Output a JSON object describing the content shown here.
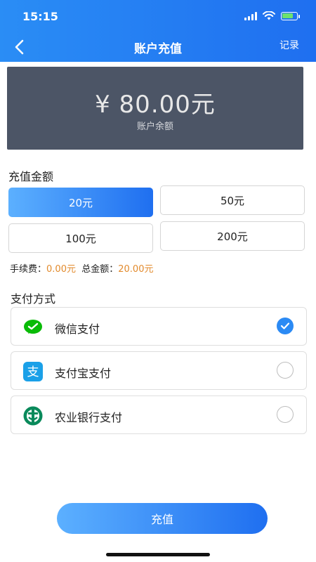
{
  "status_bar": {
    "time": "15:15"
  },
  "header": {
    "title": "账户充值",
    "record_label": "记录"
  },
  "balance": {
    "amount": "¥ 80.00元",
    "label": "账户余额"
  },
  "recharge": {
    "section_title": "充值金额",
    "options": [
      {
        "label": "20元",
        "selected": true
      },
      {
        "label": "50元",
        "selected": false
      },
      {
        "label": "100元",
        "selected": false
      },
      {
        "label": "200元",
        "selected": false
      }
    ],
    "fee_label": "手续费：",
    "fee_value": "0.00元",
    "total_label": "总金额：",
    "total_value": "20.00元"
  },
  "payment": {
    "section_title": "支付方式",
    "methods": [
      {
        "label": "微信支付",
        "icon": "wechat-icon",
        "checked": true
      },
      {
        "label": "支付宝支付",
        "icon": "alipay-icon",
        "checked": false
      },
      {
        "label": "农业银行支付",
        "icon": "abc-bank-icon",
        "checked": false
      }
    ]
  },
  "submit": {
    "label": "充值"
  },
  "colors": {
    "primary": "#1f6ff0",
    "card": "#4c5566",
    "accent_orange": "#e28a2c",
    "wechat": "#09bb07",
    "alipay": "#1aa0e8",
    "abc": "#0a8a5b"
  }
}
